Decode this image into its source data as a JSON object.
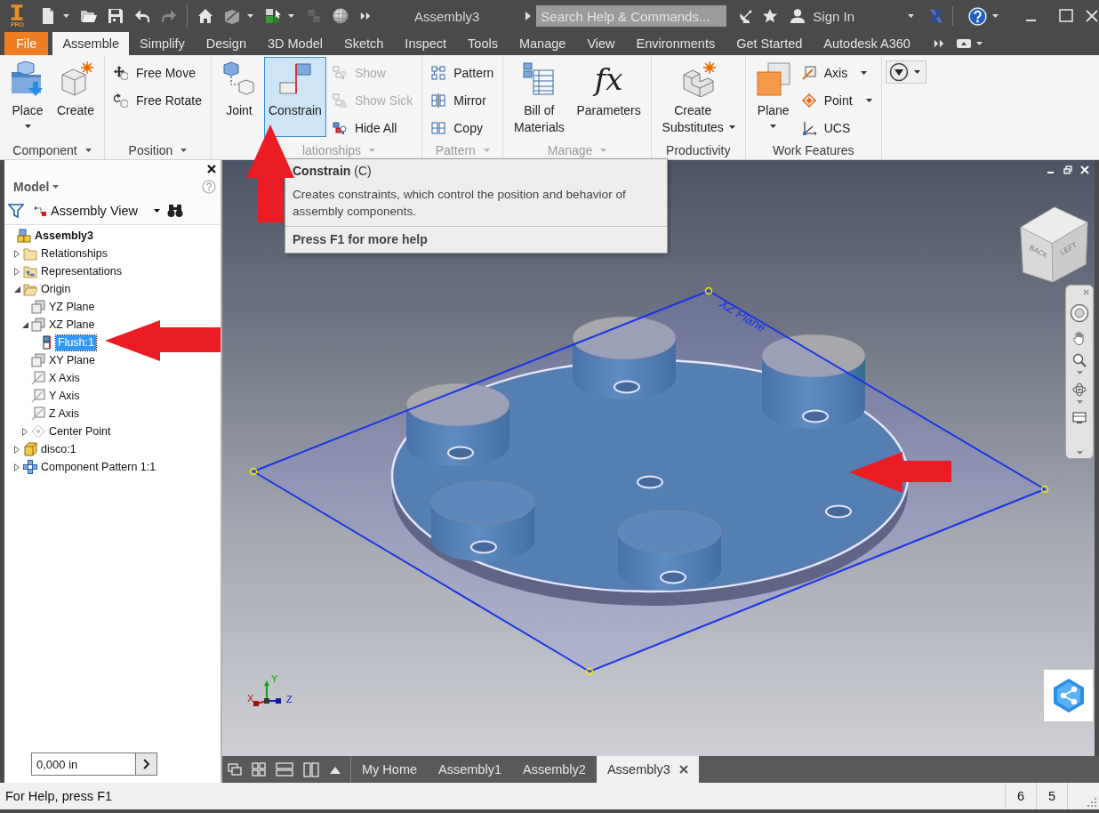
{
  "title_bar": {
    "logo_badge": "PRO",
    "quick_access": [
      {
        "disabled": false,
        "dropdown": true
      },
      {
        "disabled": false,
        "dropdown": false
      },
      {
        "disabled": false,
        "dropdown": false
      },
      {
        "disabled": false,
        "dropdown": false
      },
      {
        "disabled": true,
        "dropdown": false
      },
      {
        "disabled": false,
        "dropdown": false
      },
      {
        "disabled": false,
        "dropdown": true
      },
      {
        "disabled": false,
        "dropdown": true
      },
      {
        "disabled": true,
        "dropdown": false
      },
      {
        "disabled": false,
        "dropdown": false
      }
    ],
    "title": "Assembly3",
    "search": {
      "placeholder": "Search Help & Commands..."
    },
    "sign_in": "Sign In"
  },
  "tabs": [
    {
      "label": "File",
      "kind": "menu",
      "selected": false
    },
    {
      "label": "Assemble",
      "kind": "tab",
      "selected": true
    },
    {
      "label": "Simplify",
      "kind": "tab",
      "selected": false
    },
    {
      "label": "Design",
      "kind": "tab",
      "selected": false
    },
    {
      "label": "3D Model",
      "kind": "tab",
      "selected": false
    },
    {
      "label": "Sketch",
      "kind": "tab",
      "selected": false
    },
    {
      "label": "Inspect",
      "kind": "tab",
      "selected": false
    },
    {
      "label": "Tools",
      "kind": "tab",
      "selected": false
    },
    {
      "label": "Manage",
      "kind": "tab",
      "selected": false
    },
    {
      "label": "View",
      "kind": "tab",
      "selected": false
    },
    {
      "label": "Environments",
      "kind": "tab",
      "selected": false
    },
    {
      "label": "Get Started",
      "kind": "tab",
      "selected": false
    },
    {
      "label": "Autodesk A360",
      "kind": "tab",
      "selected": false
    }
  ],
  "ribbon": {
    "panels": [
      {
        "title": "Component",
        "dropdown": true,
        "dimmed": false,
        "buttons": [
          {
            "label": "Place",
            "kind": "large",
            "dropdown": true,
            "hovered": false,
            "disabled": false
          },
          {
            "label": "Create",
            "kind": "large",
            "dropdown": false,
            "hovered": false,
            "disabled": false
          }
        ]
      },
      {
        "title": "Position",
        "dropdown": true,
        "dimmed": false,
        "buttons": [
          {
            "label": "Free Move",
            "kind": "small",
            "dropdown": false,
            "hovered": false,
            "disabled": false
          },
          {
            "label": "Free Rotate",
            "kind": "small",
            "dropdown": false,
            "hovered": false,
            "disabled": false
          }
        ]
      },
      {
        "title": "lationships",
        "dropdown": true,
        "dimmed": true,
        "buttons": [
          {
            "label": "Joint",
            "kind": "large",
            "dropdown": false,
            "hovered": false,
            "disabled": false
          },
          {
            "label": "Constrain",
            "kind": "large",
            "dropdown": false,
            "hovered": true,
            "disabled": false
          },
          {
            "label": "Show",
            "kind": "small",
            "dropdown": false,
            "hovered": false,
            "disabled": true
          },
          {
            "label": "Show Sick",
            "kind": "small",
            "dropdown": false,
            "hovered": false,
            "disabled": true
          },
          {
            "label": "Hide All",
            "kind": "small",
            "dropdown": false,
            "hovered": false,
            "disabled": false
          }
        ]
      },
      {
        "title": "Pattern",
        "dropdown": true,
        "dimmed": true,
        "buttons": [
          {
            "label": "Pattern",
            "kind": "small",
            "dropdown": false,
            "hovered": false,
            "disabled": false
          },
          {
            "label": "Mirror",
            "kind": "small",
            "dropdown": false,
            "hovered": false,
            "disabled": false
          },
          {
            "label": "Copy",
            "kind": "small",
            "dropdown": false,
            "hovered": false,
            "disabled": false
          }
        ]
      },
      {
        "title": "Manage",
        "dropdown": true,
        "dimmed": true,
        "buttons": [
          {
            "label": "Bill of Materials",
            "kind": "large",
            "dropdown": false,
            "hovered": false,
            "disabled": false
          },
          {
            "label": "Parameters",
            "kind": "large",
            "glyph": "fx",
            "dropdown": false,
            "hovered": false,
            "disabled": false
          }
        ]
      },
      {
        "title": "Productivity",
        "dropdown": false,
        "dimmed": false,
        "buttons": [
          {
            "label": "Create Substitutes",
            "kind": "large",
            "dropdown": true,
            "hovered": false,
            "disabled": false
          }
        ]
      },
      {
        "title": "Work Features",
        "dropdown": false,
        "dimmed": false,
        "buttons": [
          {
            "label": "Plane",
            "kind": "large",
            "dropdown": true,
            "hovered": false,
            "disabled": false
          },
          {
            "label": "Axis",
            "kind": "small",
            "dropdown": true,
            "hovered": false,
            "disabled": false
          },
          {
            "label": "Point",
            "kind": "small",
            "dropdown": true,
            "hovered": false,
            "disabled": false
          },
          {
            "label": "UCS",
            "kind": "small",
            "dropdown": false,
            "hovered": false,
            "disabled": false
          }
        ]
      }
    ]
  },
  "tooltip": {
    "title": "**Constrain** (C)",
    "description": "Creates constraints, which control the position and behavior of assembly components.",
    "help": "Press F1 for more help"
  },
  "browser": {
    "title": "Model",
    "view": "Assembly View",
    "tree": [
      {
        "label": "Assembly3",
        "selected": false,
        "children": [
          {
            "label": "Relationships",
            "selected": false,
            "expanded": false
          },
          {
            "label": "Representations",
            "selected": false,
            "expanded": false
          },
          {
            "label": "Origin",
            "selected": false,
            "expanded": true,
            "children": [
              {
                "label": "YZ Plane",
                "selected": false
              },
              {
                "label": "XZ Plane",
                "selected": false,
                "expanded": true,
                "children": [
                  {
                    "label": "Flush:1",
                    "selected": true
                  }
                ]
              },
              {
                "label": "XY Plane",
                "selected": false
              },
              {
                "label": "X Axis",
                "selected": false
              },
              {
                "label": "Y Axis",
                "selected": false
              },
              {
                "label": "Z Axis",
                "selected": false
              },
              {
                "label": "Center Point",
                "selected": false,
                "expanded": false
              }
            ]
          },
          {
            "label": "disco:1",
            "selected": false,
            "expanded": false
          },
          {
            "label": "Component Pattern 1:1",
            "selected": false,
            "expanded": false
          }
        ]
      }
    ],
    "measure": {
      "value": "0,000 in"
    }
  },
  "viewport": {
    "plane_label": "XZ Plane",
    "view_cube_faces": [
      "BACK",
      "LEFT"
    ],
    "triad_labels": [
      "X",
      "Y",
      "Z"
    ]
  },
  "document_tabs": [
    {
      "label": "My Home",
      "selected": false
    },
    {
      "label": "Assembly1",
      "selected": false
    },
    {
      "label": "Assembly2",
      "selected": false
    },
    {
      "label": "Assembly3",
      "selected": true
    }
  ],
  "status_bar": {
    "message": "For Help, press F1",
    "cells": [
      "6",
      "5"
    ]
  }
}
